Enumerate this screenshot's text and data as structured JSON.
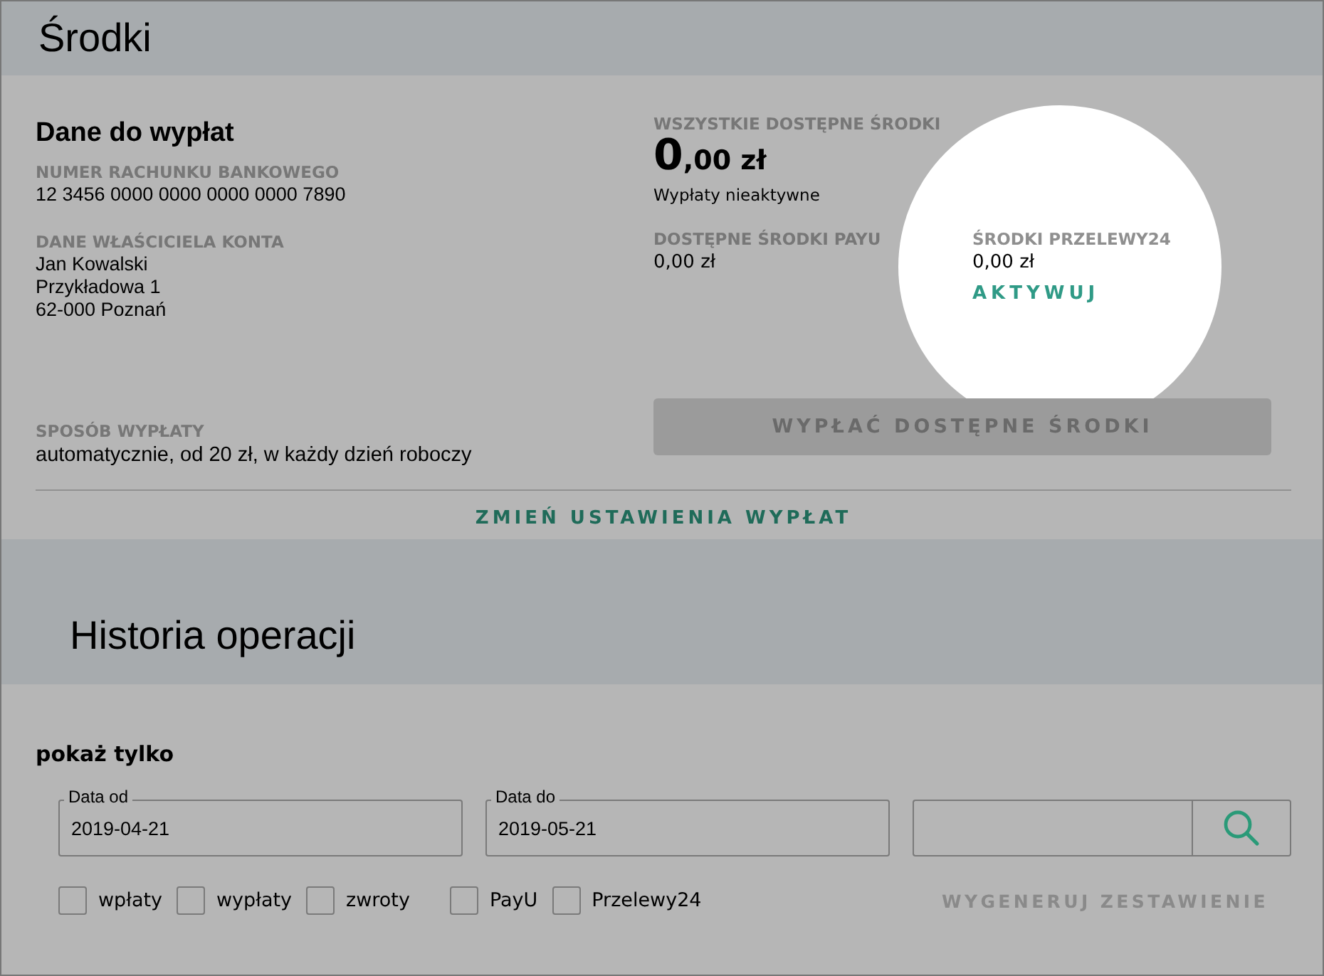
{
  "header": {
    "title": "Środki"
  },
  "payout_data": {
    "title": "Dane do wypłat",
    "fields": [
      {
        "label": "NUMER RACHUNKU BANKOWEGO",
        "lines": [
          "12 3456 0000 0000 0000 0000 7890"
        ]
      },
      {
        "label": "DANE WŁAŚCICIELA KONTA",
        "lines": [
          "Jan Kowalski",
          "Przykładowa 1",
          "62-000 Poznań"
        ]
      },
      {
        "label": "SPOSÓB WYPŁATY",
        "lines": [
          "automatycznie, od 20 zł, w każdy dzień roboczy"
        ]
      }
    ]
  },
  "funds": {
    "label": "WSZYSTKIE DOSTĘPNE ŚRODKI",
    "amount_main": "0",
    "amount_rest": ",00 zł",
    "status": "Wypłaty nieaktywne",
    "sources": [
      {
        "label": "DOSTĘPNE ŚRODKI PAYU",
        "amount": "0,00 zł",
        "active": true
      },
      {
        "label": "ŚRODKI PRZELEWY24",
        "amount": "0,00 zł",
        "active": false,
        "action": "AKTYWUJ"
      }
    ],
    "payout_button": {
      "label": "WYPŁAĆ DOSTĘPNE ŚRODKI",
      "disabled": true
    }
  },
  "settings_link": "ZMIEŃ USTAWIENIA WYPŁAT",
  "history": {
    "title": "Historia operacji",
    "filter_title": "pokaż tylko",
    "date_fields": [
      {
        "label": "Data od",
        "value": "2019-04-21"
      },
      {
        "label": "Data do",
        "value": "2019-05-21"
      }
    ],
    "checkbox_groups": [
      [
        {
          "label": "wpłaty",
          "checked": false
        },
        {
          "label": "wypłaty",
          "checked": false
        },
        {
          "label": "zwroty",
          "checked": false
        }
      ],
      [
        {
          "label": "PayU",
          "checked": false
        },
        {
          "label": "Przelewy24",
          "checked": false
        }
      ]
    ],
    "report_button": {
      "label": "WYGENERUJ ZESTAWIENIE",
      "disabled": true
    }
  }
}
